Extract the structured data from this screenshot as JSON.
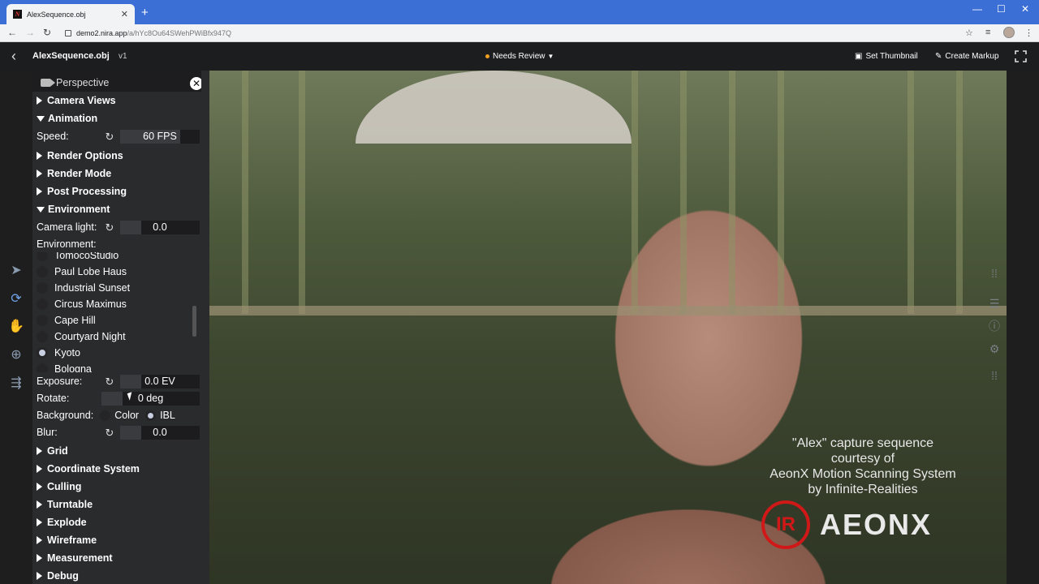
{
  "browser": {
    "tab_title": "AlexSequence.obj",
    "favicon_letter": "N",
    "url_host": "demo2.nira.app",
    "url_path": "/a/hYc8Ou64SWehPWiBfx947Q"
  },
  "header": {
    "title": "AlexSequence.obj",
    "version": "v1",
    "status": "Needs Review",
    "status_color": "#f0a020",
    "set_thumbnail": "Set Thumbnail",
    "create_markup": "Create Markup"
  },
  "panel": {
    "view_name": "Perspective",
    "sections": {
      "camera_views": "Camera Views",
      "animation": "Animation",
      "render_options": "Render Options",
      "render_mode": "Render Mode",
      "post_processing": "Post Processing",
      "environment": "Environment",
      "grid": "Grid",
      "coordinate_system": "Coordinate System",
      "culling": "Culling",
      "turntable": "Turntable",
      "explode": "Explode",
      "wireframe": "Wireframe",
      "measurement": "Measurement",
      "debug": "Debug"
    },
    "speed": {
      "label": "Speed:",
      "value": "60 FPS"
    },
    "camera_light": {
      "label": "Camera light:",
      "value": "0.0"
    },
    "environment_label": "Environment:",
    "environments": [
      {
        "name": "TomocoStudio",
        "selected": false
      },
      {
        "name": "Paul Lobe Haus",
        "selected": false
      },
      {
        "name": "Industrial Sunset",
        "selected": false
      },
      {
        "name": "Circus Maximus",
        "selected": false
      },
      {
        "name": "Cape Hill",
        "selected": false
      },
      {
        "name": "Courtyard Night",
        "selected": false
      },
      {
        "name": "Kyoto",
        "selected": true
      },
      {
        "name": "Bologna",
        "selected": false
      }
    ],
    "exposure": {
      "label": "Exposure:",
      "value": "0.0 EV"
    },
    "rotate": {
      "label": "Rotate:",
      "value": "0 deg"
    },
    "background": {
      "label": "Background:",
      "option_color": "Color",
      "option_ibl": "IBL",
      "selected": "IBL"
    },
    "blur": {
      "label": "Blur:",
      "value": "0.0"
    }
  },
  "viewport": {
    "credit_lines": [
      "\"Alex\" capture sequence",
      "courtesy of",
      "AeonX Motion Scanning System",
      "by Infinite-Realities"
    ],
    "logo_ir": "IR",
    "logo_text": "AEONX",
    "logo_color": "#d01818"
  }
}
